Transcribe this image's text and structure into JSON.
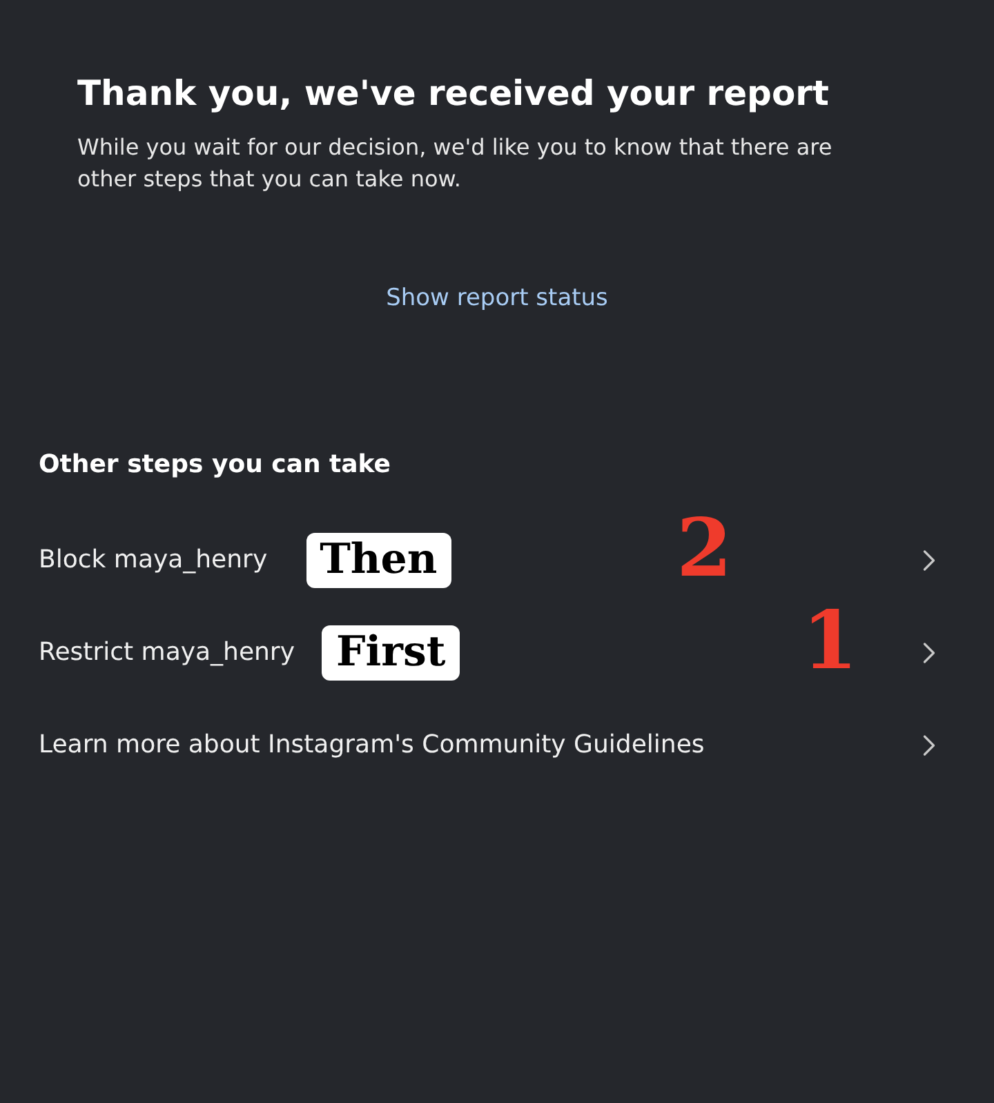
{
  "header": {
    "title": "Thank you, we've received your report",
    "message": "While you wait for our decision, we'd like you to know that there are other steps that you can take now."
  },
  "status_link": "Show report status",
  "section": {
    "title": "Other steps you can take",
    "items": [
      {
        "label": "Block maya_henry",
        "tag": "Then",
        "number": "2"
      },
      {
        "label": "Restrict maya_henry",
        "tag": "First",
        "number": "1"
      },
      {
        "label": "Learn more about Instagram's Community Guidelines"
      }
    ]
  }
}
